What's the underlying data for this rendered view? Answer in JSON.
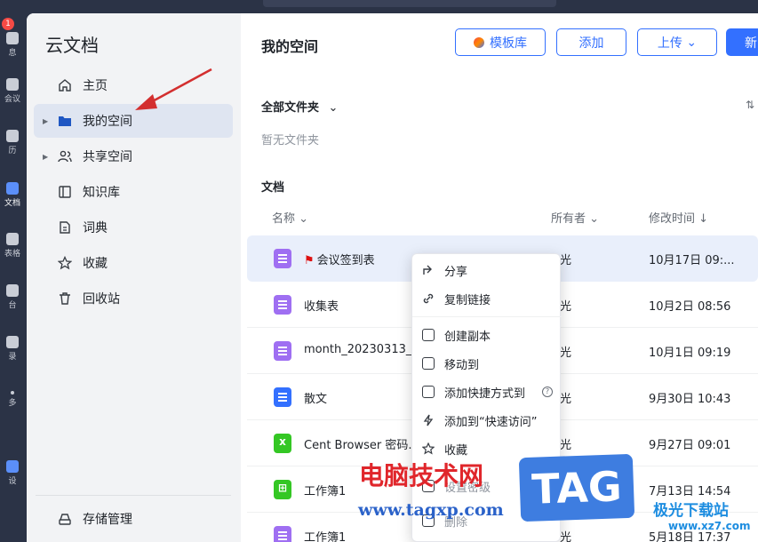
{
  "rail": {
    "badge": "1",
    "items": [
      {
        "label": "息",
        "icon": "bell-icon"
      },
      {
        "label": "会议",
        "icon": "camera-icon"
      },
      {
        "label": "历",
        "icon": "calendar-icon"
      },
      {
        "label": "文档",
        "icon": "docs-icon"
      },
      {
        "label": "表格",
        "icon": "table-icon"
      },
      {
        "label": "台",
        "icon": "workspace-icon"
      },
      {
        "label": "录",
        "icon": "contacts-icon"
      },
      {
        "label": "多",
        "icon": "more-icon"
      },
      {
        "label": "设",
        "icon": "settings-icon"
      }
    ]
  },
  "sidebar": {
    "brand": "云文档",
    "items": [
      {
        "label": "主页",
        "icon": "home-icon",
        "caret": false
      },
      {
        "label": "我的空间",
        "icon": "folder-icon",
        "caret": true,
        "active": true
      },
      {
        "label": "共享空间",
        "icon": "people-icon",
        "caret": true
      },
      {
        "label": "知识库",
        "icon": "book-icon",
        "caret": false
      },
      {
        "label": "词典",
        "icon": "dictionary-icon",
        "caret": false
      },
      {
        "label": "收藏",
        "icon": "star-icon",
        "caret": false
      },
      {
        "label": "回收站",
        "icon": "trash-icon",
        "caret": false
      }
    ],
    "storage_label": "存储管理"
  },
  "main": {
    "title": "我的空间",
    "buttons": {
      "template": "模板库",
      "add": "添加",
      "upload": "上传",
      "upload_caret": "⌄",
      "new": "新"
    },
    "folders_title": "全部文件夹",
    "folders_caret": "⌄",
    "folders_empty": "暂无文件夹",
    "sort_icon": "⇅",
    "docs_title": "文档",
    "columns": {
      "name": "名称 ⌄",
      "owner": "所有者 ⌄",
      "modified": "修改时间 ↓"
    },
    "rows": [
      {
        "name": "会议签到表",
        "flag": "⚑",
        "type": "sheet",
        "owner": "光",
        "modified": "10月17日 09:..."
      },
      {
        "name": "收集表",
        "type": "sheet",
        "owner": "光",
        "modified": "10月2日 08:56"
      },
      {
        "name": "month_20230313_2",
        "type": "sheet",
        "owner": "光",
        "modified": "10月1日 09:19"
      },
      {
        "name": "散文",
        "type": "doc",
        "owner": "光",
        "modified": "9月30日 10:43"
      },
      {
        "name": "Cent Browser 密码...",
        "type": "excel",
        "owner": "光",
        "modified": "9月27日 09:01"
      },
      {
        "name": "工作簿1",
        "type": "excel-grid",
        "owner": "光",
        "modified": "7月13日 14:54"
      },
      {
        "name": "工作簿1",
        "type": "sheet",
        "owner": "光",
        "modified": "5月18日 17:37"
      }
    ]
  },
  "context_menu": {
    "items": [
      {
        "label": "分享",
        "icon": "share-icon"
      },
      {
        "label": "复制链接",
        "icon": "link-icon"
      },
      {
        "label": "创建副本",
        "icon": "copy-icon"
      },
      {
        "label": "移动到",
        "icon": "move-icon"
      },
      {
        "label": "添加快捷方式到",
        "icon": "shortcut-icon",
        "help": "?"
      },
      {
        "label": "添加到“快速访问”",
        "icon": "lightning-icon"
      },
      {
        "label": "收藏",
        "icon": "star-icon"
      },
      {
        "label": "设置密级",
        "icon": "lock-icon"
      },
      {
        "label": "删除",
        "icon": "trash-icon"
      }
    ]
  },
  "watermark": {
    "site_cn": "电脑技术网",
    "site_url": "www.tagxp.com",
    "tag": "TAG",
    "brand2": "极光下载站",
    "brand2_url": "www.xz7.com"
  },
  "colors": {
    "accent": "#3370ff",
    "sheet": "#9f6ff2",
    "excel": "#34c724",
    "arrow": "#d32f2f"
  }
}
